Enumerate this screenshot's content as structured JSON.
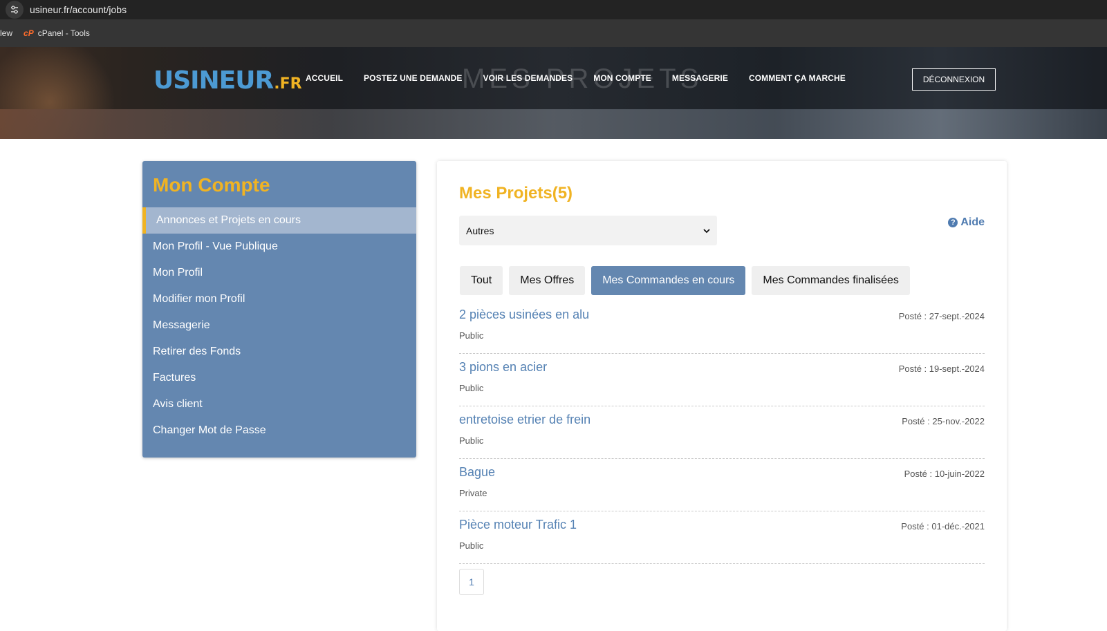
{
  "browser": {
    "url": "usineur.fr/account/jobs",
    "bookmarks": [
      "lew",
      "cPanel - Tools"
    ]
  },
  "header": {
    "logo_main": "USINEUR",
    "logo_tld": ".FR",
    "watermark": "MES PROJETS",
    "nav": [
      "ACCUEIL",
      "POSTEZ UNE DEMANDE",
      "VOIR LES DEMANDES",
      "MON COMPTE",
      "MESSAGERIE",
      "COMMENT ÇA MARCHE"
    ],
    "logout": "DÉCONNEXION"
  },
  "sidebar": {
    "title": "Mon Compte",
    "items": [
      {
        "label": "Annonces et Projets en cours",
        "active": true
      },
      {
        "label": "Mon Profil - Vue Publique"
      },
      {
        "label": "Mon Profil"
      },
      {
        "label": "Modifier mon Profil"
      },
      {
        "label": "Messagerie"
      },
      {
        "label": "Retirer des Fonds"
      },
      {
        "label": "Factures"
      },
      {
        "label": "Avis client"
      },
      {
        "label": "Changer Mot de Passe"
      }
    ]
  },
  "main": {
    "title": "Mes Projets(5)",
    "select_value": "Autres",
    "help": "Aide",
    "tabs": [
      {
        "label": "Tout"
      },
      {
        "label": "Mes Offres"
      },
      {
        "label": "Mes Commandes en cours",
        "active": true
      },
      {
        "label": "Mes Commandes finalisées"
      }
    ],
    "jobs": [
      {
        "title": "2 pièces usinées en alu",
        "date": "Posté : 27-sept.-2024",
        "visibility": "Public"
      },
      {
        "title": "3 pions en acier",
        "date": "Posté : 19-sept.-2024",
        "visibility": "Public"
      },
      {
        "title": "entretoise etrier de frein",
        "date": "Posté : 25-nov.-2022",
        "visibility": "Public"
      },
      {
        "title": "Bague",
        "date": "Posté : 10-juin-2022",
        "visibility": "Private"
      },
      {
        "title": "Pièce moteur Trafic 1",
        "date": "Posté : 01-déc.-2021",
        "visibility": "Public"
      }
    ],
    "page": "1"
  },
  "colors": {
    "accent": "#f0b323",
    "sidebar_bg": "#6487b0",
    "link": "#5481b3"
  }
}
